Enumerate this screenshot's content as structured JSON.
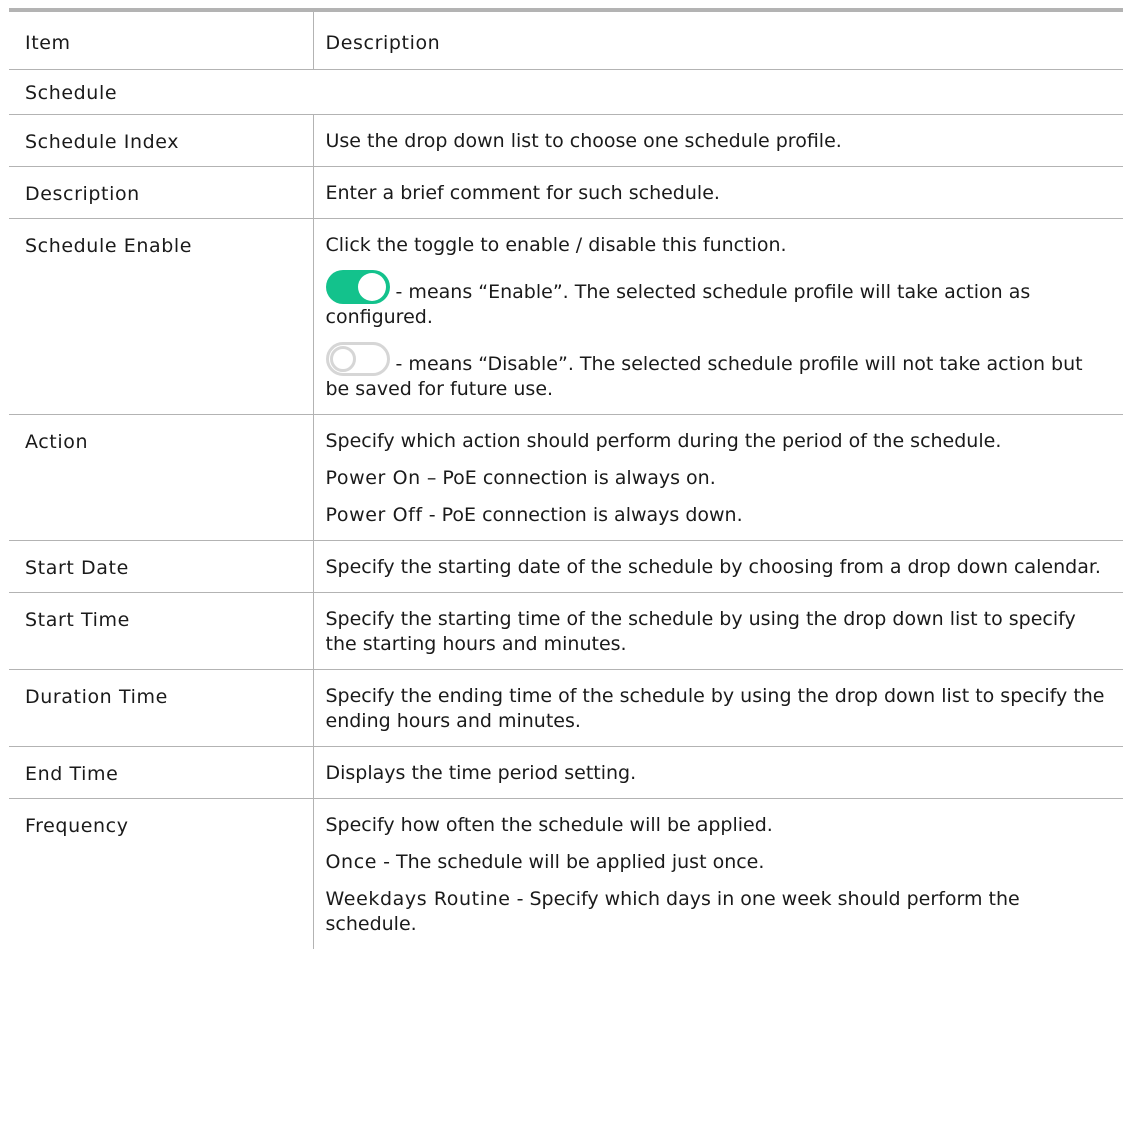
{
  "header": {
    "item": "Item",
    "description": "Description"
  },
  "section": {
    "title": "Schedule"
  },
  "rows": [
    {
      "item": "Schedule Index",
      "lines": [
        "Use the drop down list to choose one schedule profile."
      ]
    },
    {
      "item": "Description",
      "lines": [
        "Enter a brief comment for such schedule."
      ]
    },
    {
      "item": "Schedule Enable",
      "lines": [
        "Click the toggle to enable / disable this function."
      ],
      "toggle_enable_text": " - means “Enable”. The selected schedule profile will take action as configured.",
      "toggle_disable_text": " - means “Disable”. The selected schedule profile will not take action but be saved for future use.",
      "toggle_on_color": "#13c28c",
      "toggle_off_color": "#d6d6d6"
    },
    {
      "item": "Action",
      "lines": [
        "Specify which action should perform during the period of the schedule."
      ],
      "options": [
        {
          "term": "Power On",
          "text": " – PoE connection is always on."
        },
        {
          "term": "Power Off",
          "text": " - PoE connection is always down."
        }
      ]
    },
    {
      "item": "Start Date",
      "lines": [
        "Specify the starting date of the schedule by choosing from a drop down calendar."
      ]
    },
    {
      "item": "Start Time",
      "lines": [
        "Specify the starting time of the schedule by using the drop down list to specify the starting hours and minutes."
      ]
    },
    {
      "item": "Duration Time",
      "lines": [
        "Specify the ending time of the schedule by using the drop down list to specify the ending hours and minutes."
      ]
    },
    {
      "item": "End Time",
      "lines": [
        "Displays the time period setting."
      ]
    },
    {
      "item": "Frequency",
      "lines": [
        "Specify how often the schedule will be applied."
      ],
      "options": [
        {
          "term": "Once",
          "text": " - The schedule will be applied just once."
        },
        {
          "term": "Weekdays Routine",
          "text": " - Specify which days in one week should perform the schedule."
        }
      ]
    }
  ]
}
